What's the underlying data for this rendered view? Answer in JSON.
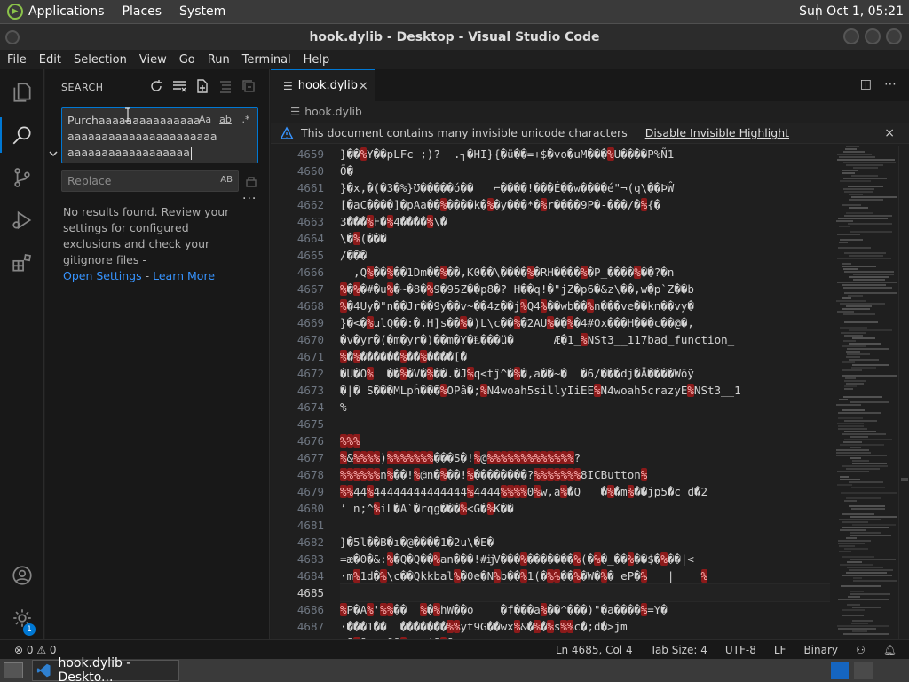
{
  "top_panel": {
    "menus": [
      "Applications",
      "Places",
      "System"
    ],
    "clock": "Sun Oct 1, 05:21"
  },
  "window": {
    "title": "hook.dylib - Desktop - Visual Studio Code"
  },
  "menubar": {
    "items": [
      "File",
      "Edit",
      "Selection",
      "View",
      "Go",
      "Run",
      "Terminal",
      "Help"
    ]
  },
  "activity_bar": {
    "active": "search",
    "settings_badge": "1"
  },
  "sidebar": {
    "title": "SEARCH",
    "search": {
      "lines": [
        "Purchaaaaaaaaaaaaaaaaaa",
        "aaaaaaaaaaaaaaaaaaaaaa",
        "aaaaaaaaaaaaaaaaaa"
      ],
      "opt_case": "Aa",
      "opt_word": "ab",
      "opt_regex": ".*"
    },
    "replace_placeholder": "Replace",
    "replace_opt": "AB",
    "more": "···",
    "no_results": "No results found. Review your settings for configured exclusions and check your gitignore files -",
    "open_settings": "Open Settings",
    "link_sep": " - ",
    "learn_more": "Learn More"
  },
  "editor": {
    "tab_label": "hook.dylib",
    "tab_close": "×",
    "breadcrumb": "hook.dylib",
    "banner_text": "This document contains many invisible unicode characters",
    "banner_action": "Disable Invisible Highlight",
    "banner_close": "×",
    "lines": [
      {
        "n": "4659",
        "t": "}��%%Y��pLFϲ ;)?  .┐�HI}{�ü��=+$�vo�uM���%%U����P%Ñ1"
      },
      {
        "n": "4660",
        "t": "Õ�"
      },
      {
        "n": "4661",
        "t": "}�x,�(�3�%}Ʊ�����ó��   ⌐����!���É��w����é\"¬(q\\��ÞŴ"
      },
      {
        "n": "4662",
        "t": "[�aC����]�pAa��%%����k�%%�y���*�%%r����9P�-���/�%%{�"
      },
      {
        "n": "4663",
        "t": "3���%%F�%%4����%%\\�"
      },
      {
        "n": "4664",
        "t": "\\�%%(���"
      },
      {
        "n": "4665",
        "t": "/���"
      },
      {
        "n": "4666",
        "t": "  ,Q%%��%%��1Dm��%%��,K0��\\����%%�RH����%%�P_����%%��?�n"
      },
      {
        "n": "4667",
        "t": "%%�%%�#�u%%�~�8�%%9�95Z��p8�? H��q!�\"jZ�p6�&z\\��,w�p`Z��b"
      },
      {
        "n": "4668",
        "t": "%%�4Uy�\"n��Jr��9y��v~��4z��j%%Q4%%��wb��%%n���ve��kn��vy�"
      },
      {
        "n": "4669",
        "t": "}�<�%%ulQ��:�.H]s��%%�)L\\c��%%�2AU%%��%%�4#Ox���H���c��@�,"
      },
      {
        "n": "4670",
        "t": "�v�yr�(�m�yr�)��m�Y�Ⱡ���ü�      Æ�1_%%NSt3__117bad_function_"
      },
      {
        "n": "4671",
        "t": "%%�%%������%%��%%����[�"
      },
      {
        "n": "4672",
        "t": "�U�O%%  ��%%�V�%%��.�J%%q<tĵ^�%%�,a��~�  �6/���dj�Ä����Wōỹ"
      },
      {
        "n": "4673",
        "t": "�|� S���MLpĥ���%%OPâ�;%%N4woah5sillyIiEE%%N4woah5crazyE%%NSt3__1"
      },
      {
        "n": "4674",
        "t": "%"
      },
      {
        "n": "4675",
        "t": ""
      },
      {
        "n": "4676",
        "t": "%%%%%%"
      },
      {
        "n": "4677",
        "t": "%%&%%%%%%%%)%%%%%%%%%%%%%%���S�!%%@%%%%%%%%%%%%%%%%%%%%%%%%%%?"
      },
      {
        "n": "4678",
        "t": "%%%%%%%%%%%%n%%��!%%@n�%%��!%%��������?%%%%%%%%%%%%%%8ICButton%%"
      },
      {
        "n": "4679",
        "t": "%%%%44%%44444444444444%%4444%%%%%%%%0%%w,a%%�Q   �%%�m%%��jp5�c d�2"
      },
      {
        "n": "4680",
        "t": "’ n;^%%iL�A`�rqg���%%<G�%%K��"
      },
      {
        "n": "4681",
        "t": ""
      },
      {
        "n": "4682",
        "t": "}�5l��B�ı�@����1�2u\\�E�"
      },
      {
        "n": "4683",
        "t": "=æ�0�&:%%�Q�Q��%%an���!#ĳV���%%�������%%(�%%�_��%%��$�%%��|<"
      },
      {
        "n": "4684",
        "t": "·m%%1d�%%\\c��Qkkbal%%�0e�N%%b��%%1(�%%%%��%%�W�%%� eP�%%   |    %%"
      },
      {
        "n": "4685",
        "t": ""
      },
      {
        "n": "4686",
        "t": "%%P�A%%'%%%%��  %%�%%hW��o    �f���a%%��^���)\"�a����%%=Y�"
      },
      {
        "n": "4687",
        "t": "·���1��  �������%%%%yt9G��wx%%&�%%�%%s%%%%c�;d�>jm"
      },
      {
        "n": "4688",
        "t": " �%%�   ��%%   ’�%%�"
      }
    ],
    "current_line": "4685"
  },
  "statusbar": {
    "problems": "⊗ 0 ⚠ 0",
    "position": "Ln 4685, Col 4",
    "tab_size": "Tab Size: 4",
    "encoding": "UTF-8",
    "eol": "LF",
    "language": "Binary"
  },
  "taskbar": {
    "task_label": "hook.dylib - Deskto..."
  },
  "colors": {
    "accent": "#0078d4",
    "highlight": "#8b1a1a",
    "link": "#3794ff"
  }
}
